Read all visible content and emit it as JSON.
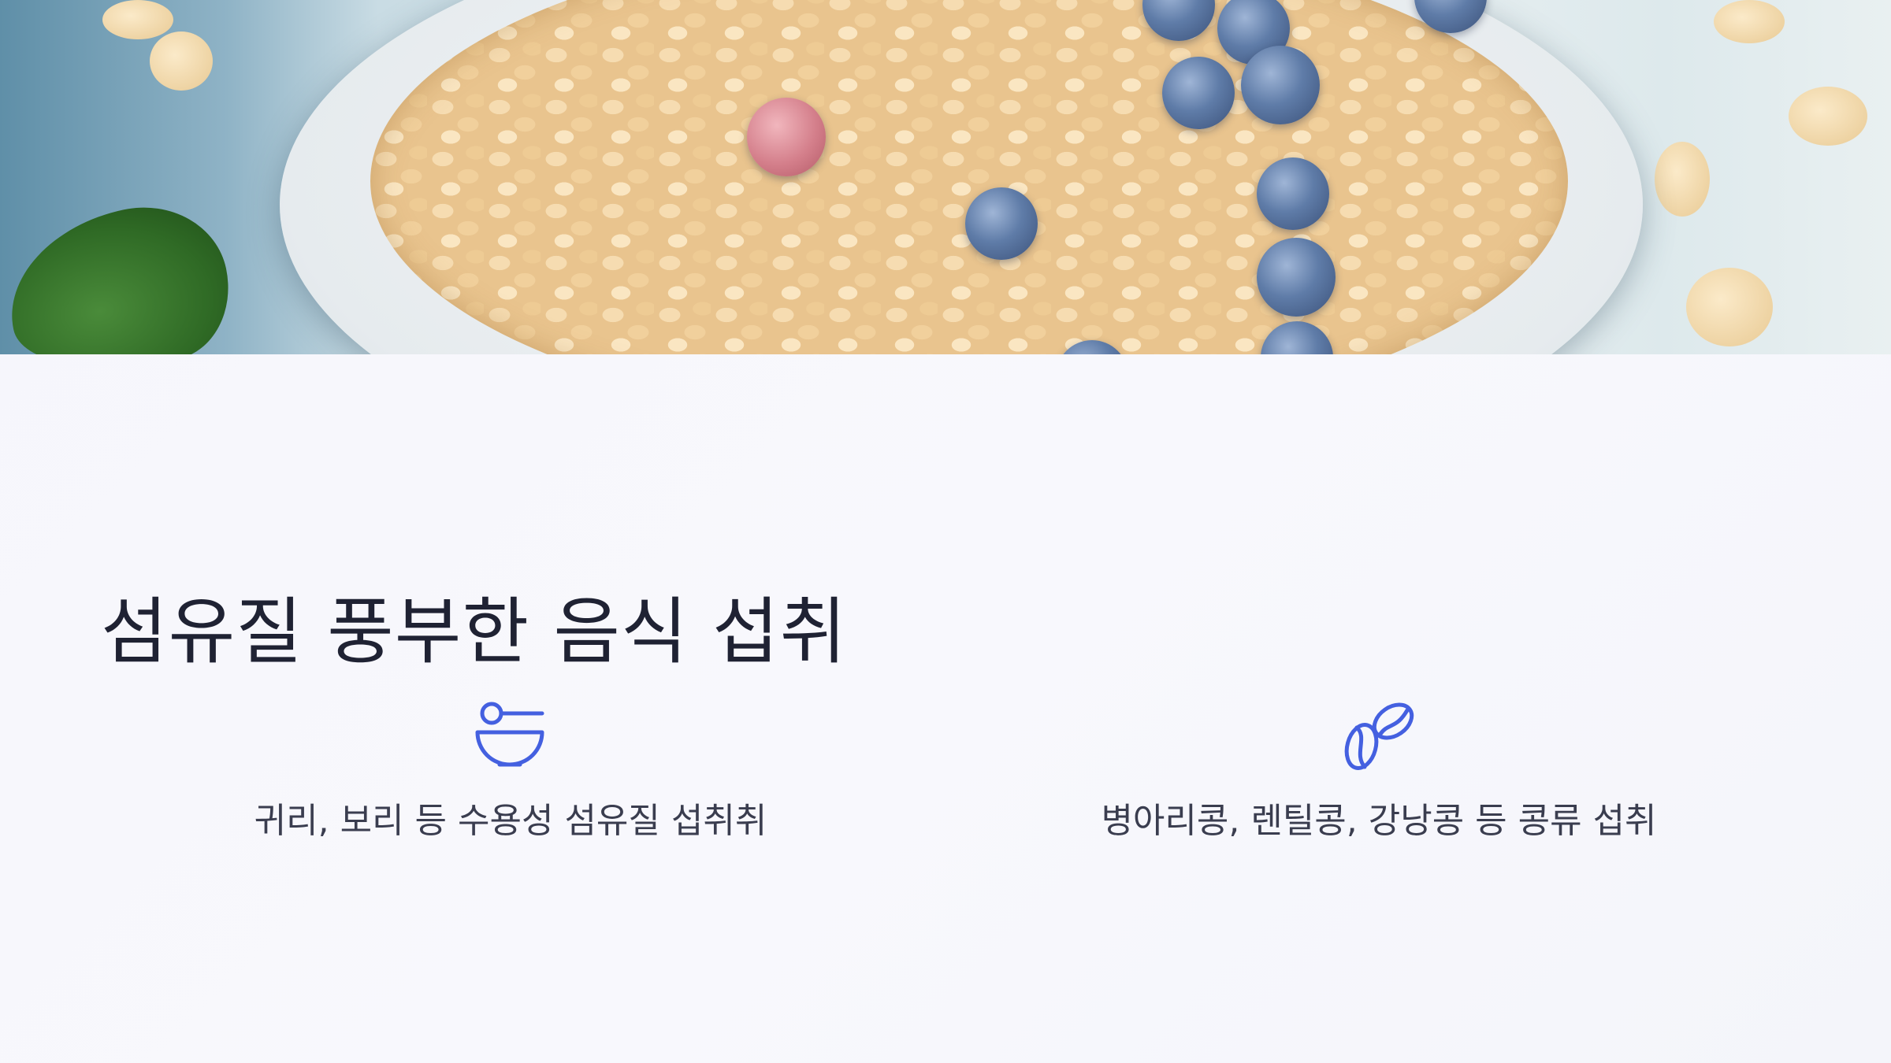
{
  "slide": {
    "title": "섬유질 풍부한 음식 섭취",
    "items": [
      {
        "icon": "bowl-icon",
        "label": "귀리, 보리 등 수용성 섬유질 섭취취"
      },
      {
        "icon": "beans-icon",
        "label": "병아리콩, 렌틸콩, 강낭콩 등 콩류 섭취"
      }
    ]
  },
  "colors": {
    "accent": "#4460e0",
    "title_text": "#1f2233",
    "body_text": "#3a3d4f",
    "background": "#f7f7fc"
  }
}
